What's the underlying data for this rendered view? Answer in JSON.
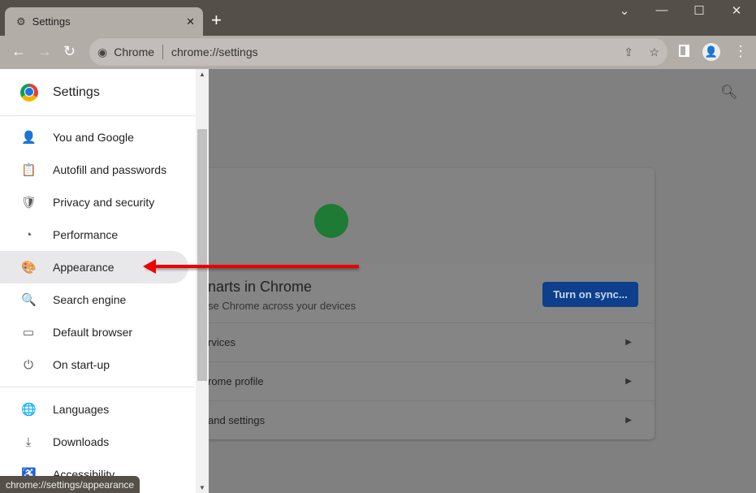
{
  "tab": {
    "title": "Settings",
    "close": "✕",
    "new_tab": "+"
  },
  "window": {
    "menu": "⌄",
    "minimize": "—",
    "maximize": "☐",
    "close": "✕"
  },
  "omnibox": {
    "site": "Chrome",
    "url": "chrome://settings"
  },
  "sidebar": {
    "title": "Settings",
    "items": [
      {
        "label": "You and Google",
        "icon": "👤"
      },
      {
        "label": "Autofill and passwords",
        "icon": "📋"
      },
      {
        "label": "Privacy and security",
        "icon": "🛡"
      },
      {
        "label": "Performance",
        "icon": "◔"
      },
      {
        "label": "Appearance",
        "icon": "🎨"
      },
      {
        "label": "Search engine",
        "icon": "🔍"
      },
      {
        "label": "Default browser",
        "icon": "▭"
      },
      {
        "label": "On start-up",
        "icon": "⏻"
      },
      {
        "label": "Languages",
        "icon": "🌐"
      },
      {
        "label": "Downloads",
        "icon": "⤓"
      },
      {
        "label": "Accessibility",
        "icon": "♿"
      }
    ]
  },
  "main": {
    "title": "narts in Chrome",
    "subtitle": "se Chrome across your devices",
    "sync_button": "Turn on sync...",
    "rows": [
      "rvices",
      "rome profile",
      "and settings"
    ]
  },
  "status_url": "chrome://settings/appearance"
}
